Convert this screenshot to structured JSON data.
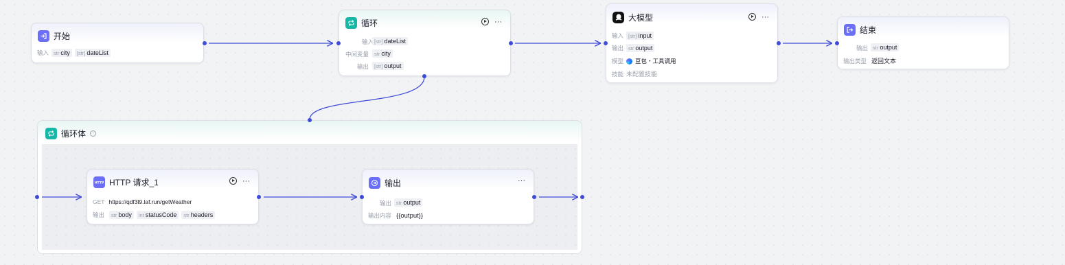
{
  "nodes": {
    "start": {
      "title": "开始",
      "input_label": "输入",
      "inputs": [
        {
          "type": "str",
          "name": "city"
        },
        {
          "type": "[str]",
          "name": "dateList"
        }
      ]
    },
    "loop": {
      "title": "循环",
      "rows": [
        {
          "label": "输入",
          "type": "[str]",
          "name": "dateList"
        },
        {
          "label": "中间变量",
          "type": "str",
          "name": "city"
        },
        {
          "label": "输出",
          "type": "[str]",
          "name": "output"
        }
      ]
    },
    "llm": {
      "title": "大模型",
      "rows": [
        {
          "label": "输入",
          "type": "[str]",
          "name": "input"
        },
        {
          "label": "输出",
          "type": "str",
          "name": "output"
        }
      ],
      "model_label": "模型",
      "model_value": "豆包・工具调用",
      "skill_label": "技能",
      "skill_value": "未配置技能"
    },
    "end": {
      "title": "结束",
      "output_label": "输出",
      "output_type": "str",
      "output_name": "output",
      "type_label": "输出类型",
      "type_value": "返回文本"
    },
    "loop_body": {
      "title": "循环体"
    },
    "http": {
      "title": "HTTP 请求_1",
      "method": "GET",
      "url": "https://qdf3l9.laf.run/getWeather",
      "output_label": "输出",
      "outputs": [
        {
          "type": "str",
          "name": "body"
        },
        {
          "type": "int",
          "name": "statusCode"
        },
        {
          "type": "str",
          "name": "headers"
        }
      ]
    },
    "output_node": {
      "title": "输出",
      "output_label": "输出",
      "output_type": "str",
      "output_name": "output",
      "content_label": "输出内容",
      "content_value": "{{output}}"
    }
  },
  "colors": {
    "edge": "#3f4bd8",
    "icon_purple": "#6b6ef7",
    "icon_teal": "#15b8a6"
  },
  "icons": {
    "start": "enter-icon",
    "loop": "loop-icon",
    "llm": "model-logo-icon",
    "end": "exit-icon",
    "http": "http-icon",
    "output": "output-icon"
  }
}
